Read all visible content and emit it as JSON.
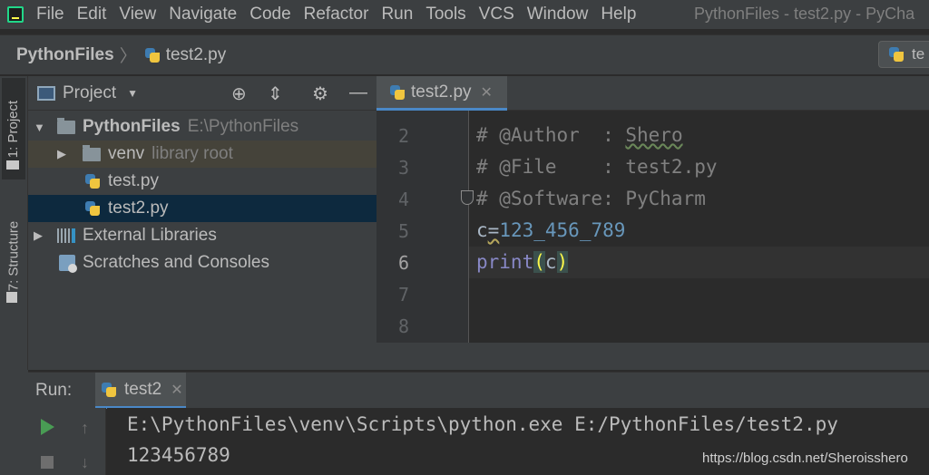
{
  "menubar": {
    "items": [
      "File",
      "Edit",
      "View",
      "Navigate",
      "Code",
      "Refactor",
      "Run",
      "Tools",
      "VCS",
      "Window",
      "Help"
    ],
    "window_title": "PythonFiles - test2.py - PyCha"
  },
  "navbar": {
    "root": "PythonFiles",
    "file": "test2.py",
    "run_config": "te"
  },
  "left_strip": {
    "project_tab": "1: Project",
    "structure_tab": "7: Structure"
  },
  "project_panel": {
    "title": "Project",
    "tree": {
      "root_name": "PythonFiles",
      "root_path": "E:\\PythonFiles",
      "venv_name": "venv",
      "venv_note": "library root",
      "file1": "test.py",
      "file2": "test2.py",
      "external": "External Libraries",
      "scratches": "Scratches and Consoles"
    }
  },
  "editor": {
    "tab_label": "test2.py",
    "line_numbers": [
      "2",
      "3",
      "4",
      "5",
      "6",
      "7",
      "8"
    ],
    "current_line": "6",
    "code": {
      "line2_prefix": "# @Author  : ",
      "line2_name": "Shero",
      "line3": "# @File    : test2.py",
      "line4": "# @Software: PyCharm",
      "line5_var": "c",
      "line5_eq": "=",
      "line5_num": "123_456_789",
      "line6_func": "print",
      "line6_open": "(",
      "line6_arg": "c",
      "line6_close": ")"
    }
  },
  "run_panel": {
    "label": "Run:",
    "tab_label": "test2",
    "console_lines": [
      "E:\\PythonFiles\\venv\\Scripts\\python.exe E:/PythonFiles/test2.py",
      "123456789"
    ]
  },
  "watermark": "https://blog.csdn.net/Sheroisshero",
  "colors": {
    "background": "#2b2b2b",
    "panel": "#3c3f41",
    "selection": "#0d293e",
    "accent": "#4a88c7",
    "number": "#6897bb",
    "builtin": "#8888c6",
    "comment": "#808080"
  }
}
